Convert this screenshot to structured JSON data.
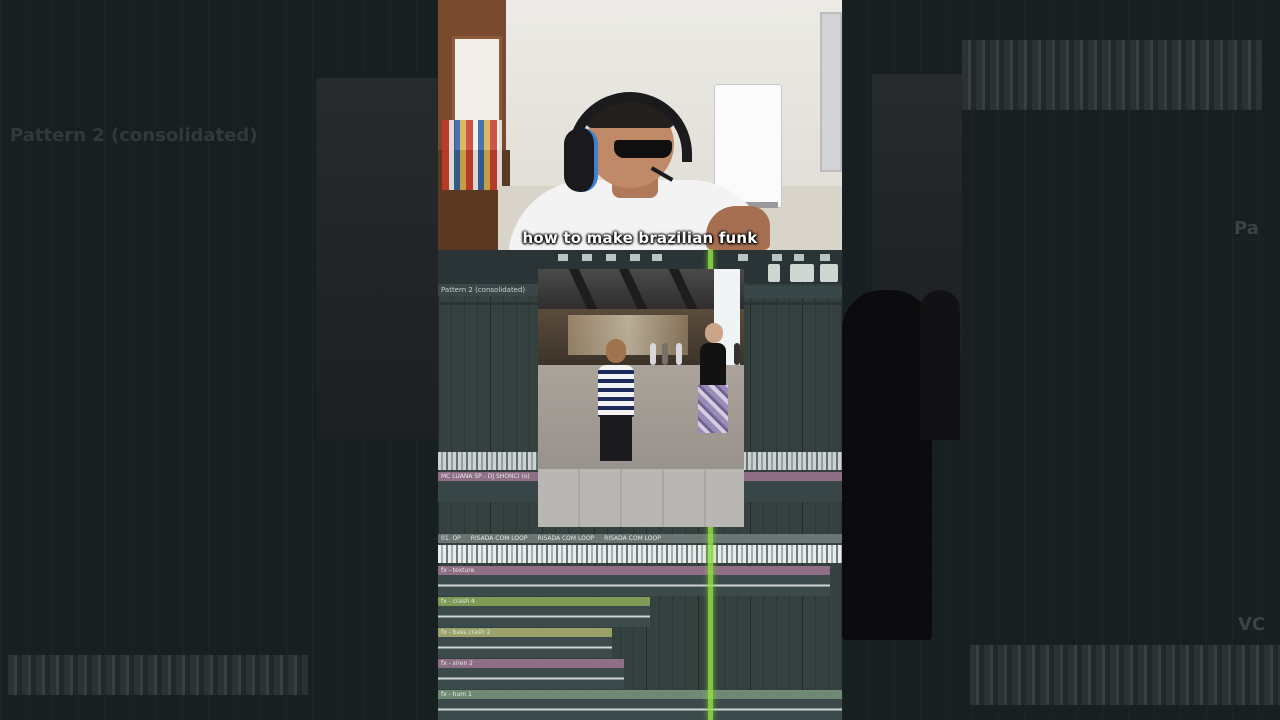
{
  "caption": "how to make brazilian funk",
  "daw": {
    "pattern_label": "Pattern 2 (consolidated)",
    "clips": [
      {
        "label": "MC LUANA SP - DJ SHONCI (o)"
      },
      {
        "label": "01. OP"
      },
      {
        "label": "RISADA COM LOOP"
      },
      {
        "label": "RISADA COM LOOP"
      },
      {
        "label": "RISADA COM LOOP"
      },
      {
        "label": "fx - texture"
      },
      {
        "label": "fx - crash 4"
      },
      {
        "label": "fx - bass crash 2"
      },
      {
        "label": "fx - siren 2"
      },
      {
        "label": "fx - hum 1"
      }
    ],
    "side_pattern_label": "Pattern 2 (consolidated)",
    "side_right_labels": [
      "Pa",
      "VC"
    ]
  },
  "colors": {
    "playhead": "#8fe040",
    "caption": "#ffffff",
    "clip_purple": "#8e6f86",
    "clip_green": "#7f9a56",
    "clip_gray": "#6b7574"
  }
}
